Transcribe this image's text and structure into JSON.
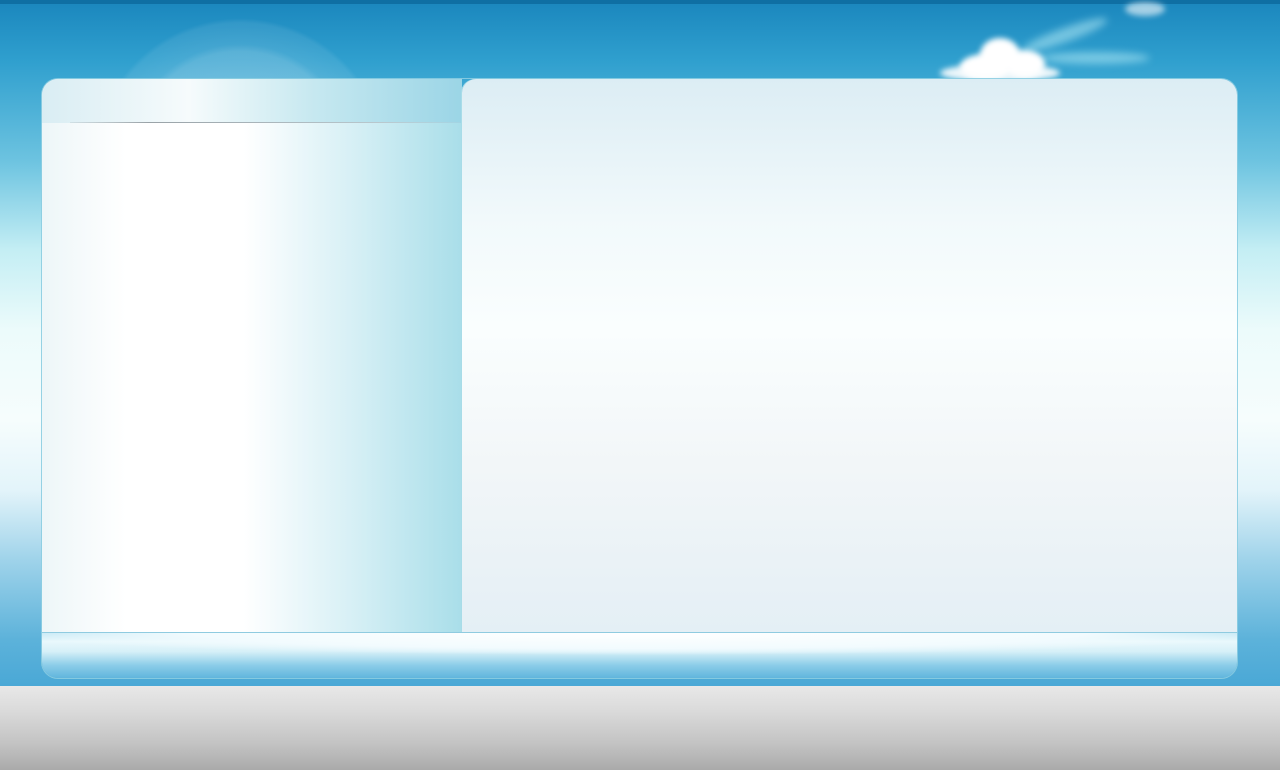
{
  "page": {
    "theme": "sky-blue",
    "colors": {
      "sky_top": "#1a86bd",
      "sky_mid": "#ecfbfb",
      "panel_border": "#8fcbe0",
      "bottom_bar": "#5db3dc",
      "floor": "#c2c2c2"
    }
  },
  "decorations": {
    "halo": "halo-decoration",
    "clouds": "cloud-decoration"
  },
  "panel": {
    "left_pane": {
      "header": "",
      "content": ""
    },
    "right_pane": {
      "content": ""
    },
    "footer": ""
  }
}
